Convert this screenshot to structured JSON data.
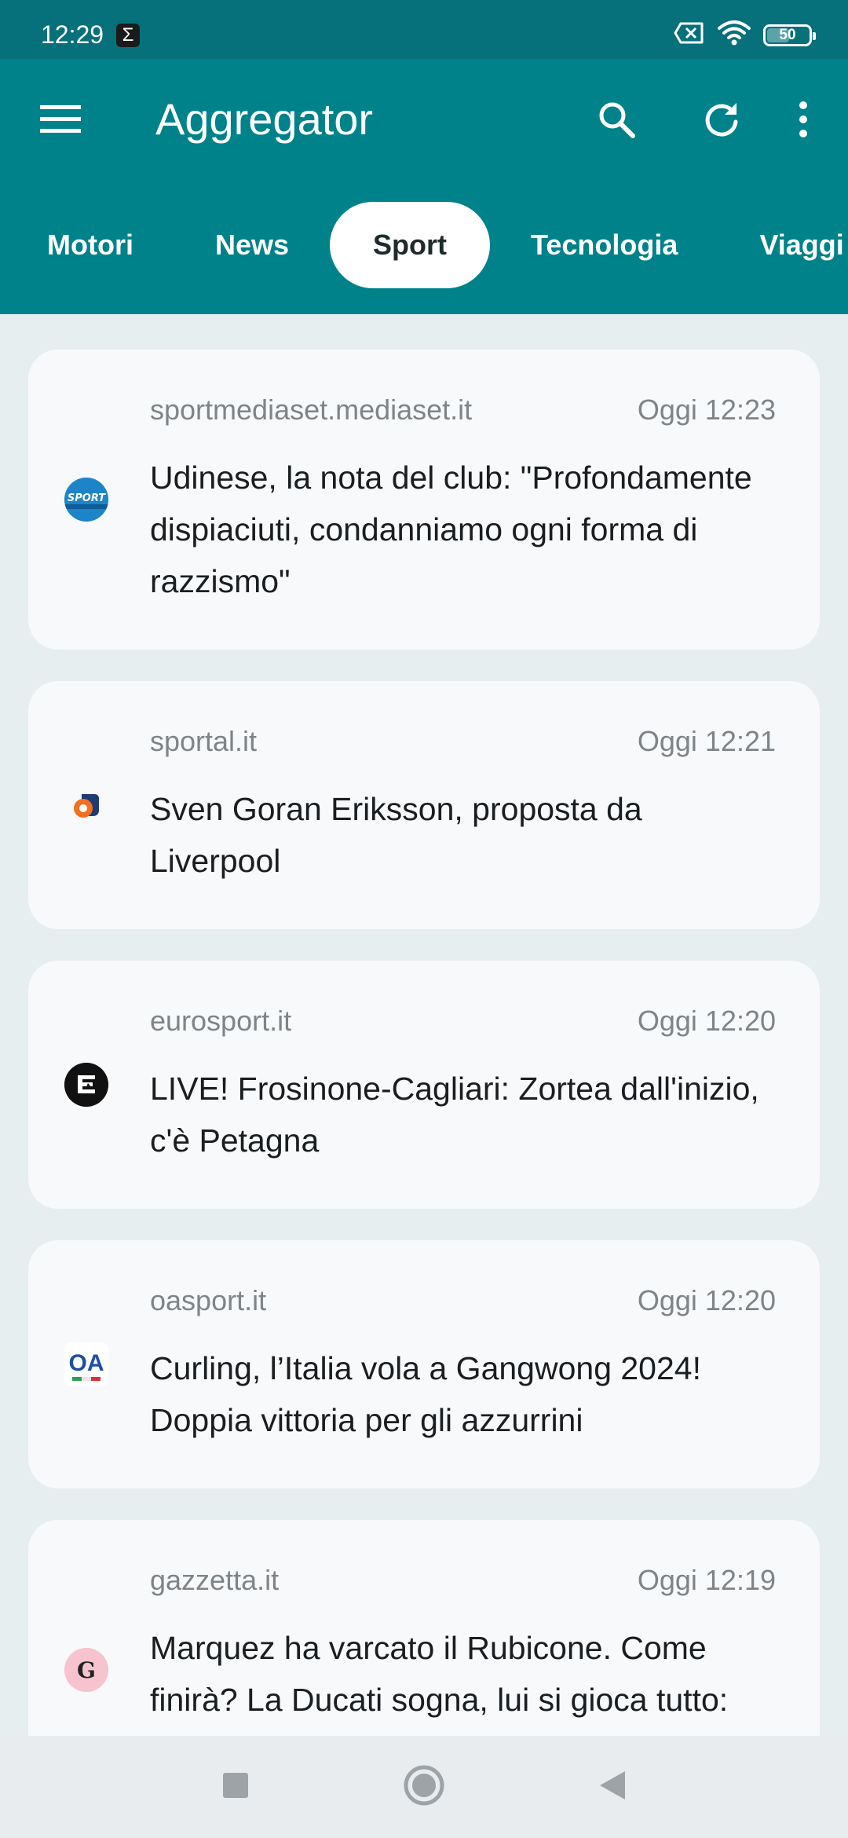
{
  "status": {
    "time": "12:29",
    "app_badge": "Σ",
    "battery": "50"
  },
  "appbar": {
    "title": "Aggregator",
    "icons": [
      "menu-icon",
      "search-icon",
      "refresh-icon",
      "more-vert-icon"
    ]
  },
  "tabs": [
    {
      "label": "Motori",
      "active": false
    },
    {
      "label": "News",
      "active": false
    },
    {
      "label": "Sport",
      "active": true
    },
    {
      "label": "Tecnologia",
      "active": false
    },
    {
      "label": "Viaggi",
      "active": false
    }
  ],
  "articles": [
    {
      "source": "sportmediaset.mediaset.it",
      "time": "Oggi 12:23",
      "headline": "Udinese, la nota del club: \"Profondamente dispiaciuti, condanniamo ogni forma di razzismo\"",
      "logo": "sportmediaset-logo"
    },
    {
      "source": "sportal.it",
      "time": "Oggi 12:21",
      "headline": "Sven Goran Eriksson, proposta da Liverpool",
      "logo": "sportal-logo"
    },
    {
      "source": "eurosport.it",
      "time": "Oggi 12:20",
      "headline": "LIVE! Frosinone-Cagliari: Zortea dall'inizio, c'è Petagna",
      "logo": "eurosport-logo"
    },
    {
      "source": "oasport.it",
      "time": "Oggi 12:20",
      "headline": "Curling, l’Italia vola a Gangwong 2024! Doppia vittoria per gli azzurrini",
      "logo": "oasport-logo"
    },
    {
      "source": "gazzetta.it",
      "time": "Oggi 12:19",
      "headline": "Marquez ha varcato il Rubicone. Come finirà? La Ducati sogna, lui si gioca tutto: ecco perché - La Gazzetta dello Sport",
      "logo": "gazzetta-logo"
    }
  ],
  "logo_text": {
    "sportmediaset": "SPORT",
    "oasport": "OA",
    "gazzetta": "G"
  },
  "colors": {
    "statusbar": "#06707b",
    "appbar": "#00828a",
    "background": "#e7eef0",
    "card": "#f7f9fb"
  }
}
